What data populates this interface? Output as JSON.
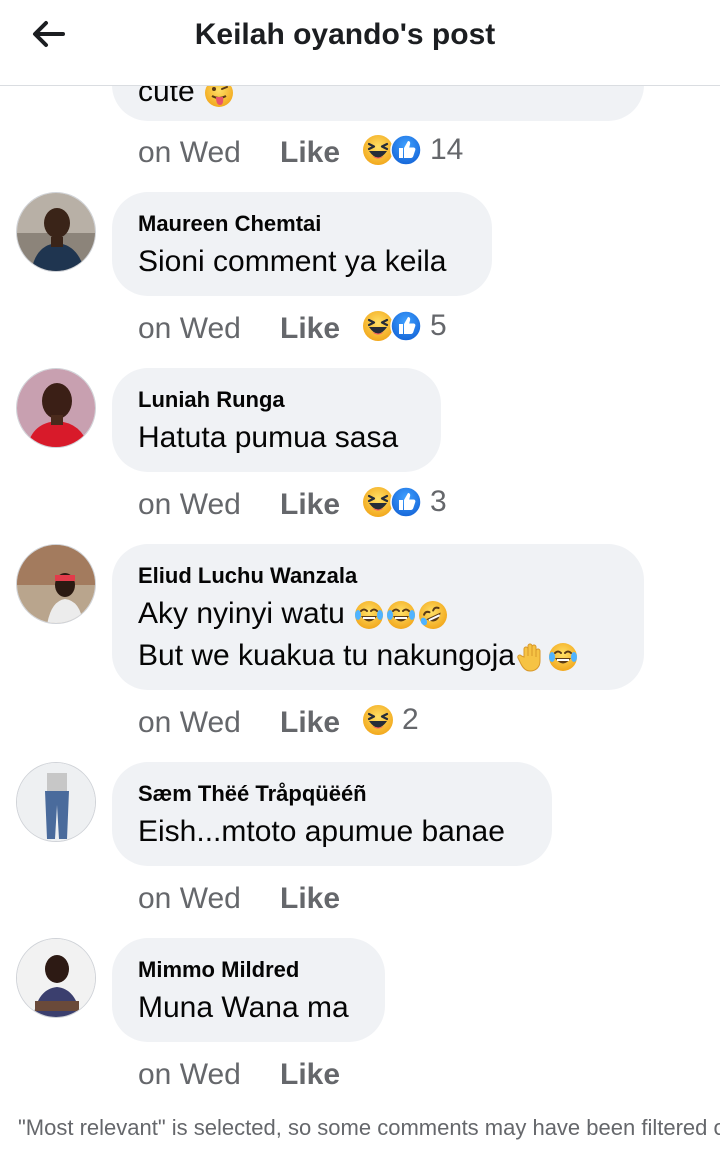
{
  "header": {
    "title": "Keilah oyando's post",
    "back_icon": "arrow-left-icon"
  },
  "partial_comment": {
    "text": "cute",
    "emoji": "tongue-face-emoji",
    "time": "on Wed",
    "like_label": "Like",
    "reaction_icons": [
      "laughing-face-icon",
      "thumbs-up-icon"
    ],
    "reaction_count": "14"
  },
  "comments": [
    {
      "author": "Maureen Chemtai",
      "lines": [
        "Sioni comment ya keila"
      ],
      "time": "on Wed",
      "like_label": "Like",
      "reaction_icons": [
        "laughing-face-icon",
        "thumbs-up-icon"
      ],
      "reaction_count": "5"
    },
    {
      "author": "Luniah Runga",
      "lines": [
        "Hatuta pumua sasa"
      ],
      "time": "on Wed",
      "like_label": "Like",
      "reaction_icons": [
        "laughing-face-icon",
        "thumbs-up-icon"
      ],
      "reaction_count": "3"
    },
    {
      "author": "Eliud Luchu Wanzala",
      "lines": [
        "Aky nyinyi watu",
        "But we kuakua tu nakungoja"
      ],
      "time": "on Wed",
      "like_label": "Like",
      "reaction_icons": [
        "laughing-face-icon"
      ],
      "reaction_count": "2"
    },
    {
      "author": "Sæm Thëé Tråpqüëéñ",
      "lines": [
        "Eish...mtoto apumue banae"
      ],
      "time": "on Wed",
      "like_label": "Like",
      "reaction_icons": [],
      "reaction_count": ""
    },
    {
      "author": "Mimmo Mildred",
      "lines": [
        "Muna Wana ma"
      ],
      "time": "on Wed",
      "like_label": "Like",
      "reaction_icons": [],
      "reaction_count": ""
    }
  ],
  "footer": {
    "note": "\"Most relevant\" is selected, so some comments may have been filtered out."
  },
  "colors": {
    "bubble": "#f0f2f5",
    "muted_text": "#65676b",
    "like_blue": "#1877f2",
    "haha_yellow": "#f7b125"
  }
}
